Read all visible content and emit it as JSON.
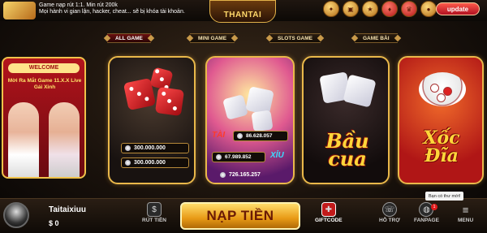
{
  "header": {
    "notice_line1": "Game nạp rút 1:1. Min rút 200k",
    "notice_line2": "Mọi hành vi gian lận, hacker, cheat... sẽ bị khóa tài khoản.",
    "logo_text": "THANTAI",
    "update_label": "update",
    "top_icons": [
      "gift-icon",
      "chest-icon",
      "reward-icon",
      "event-icon",
      "vip-icon",
      "coin-icon"
    ]
  },
  "tabs": [
    {
      "label": "ALL GAME",
      "active": true
    },
    {
      "label": "MINI GAME",
      "active": false
    },
    {
      "label": "SLOTS GAME",
      "active": false
    },
    {
      "label": "GAME BÀI",
      "active": false
    }
  ],
  "promo": {
    "welcome": "WELCOME",
    "headline": "Mời Ra Mắt Game 11.X.X Live Gái Xinh"
  },
  "games": {
    "dice": {
      "jackpot1": "300.000.000",
      "jackpot2": "300.000.000"
    },
    "taixiu": {
      "tai_label": "TÀI",
      "xiu_label": "XỈU",
      "tai_value": "86.628.057",
      "xiu_value": "67.989.852",
      "total": "726.165.257"
    },
    "baucua": {
      "title": "Bầu cua"
    },
    "xocdia": {
      "title": "Xốc Đĩa"
    }
  },
  "user": {
    "name": "Taitaixiuu",
    "balance": "$ 0"
  },
  "bottom": {
    "withdraw_label": "RÚT TIỀN",
    "deposit_label": "NẠP TIỀN",
    "giftcode_label": "GIFTCODE",
    "support_label": "HỖ TRỢ",
    "fanpage_label": "FANPAGE",
    "menu_label": "MENU",
    "fanpage_badge": "1",
    "tooltip": "Bạn có thư mới!"
  },
  "colors": {
    "accent_gold": "#e9b84a",
    "accent_red": "#b01616"
  }
}
